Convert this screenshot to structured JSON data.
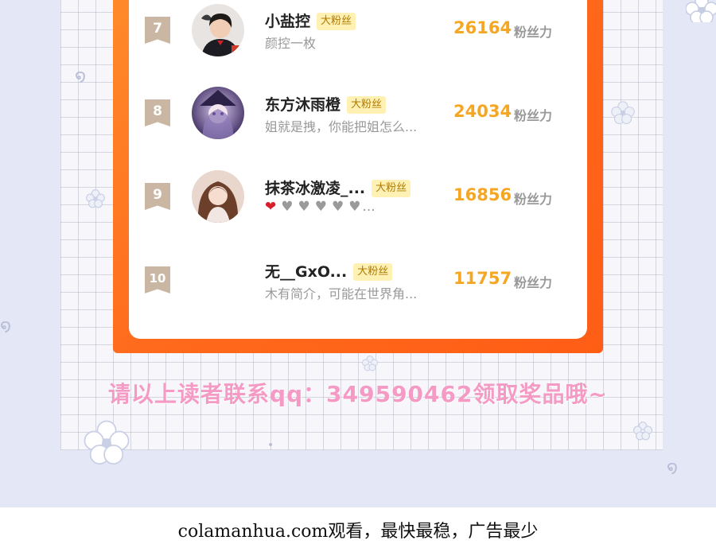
{
  "ranking": {
    "rows": [
      {
        "rank": "7",
        "name": "小盐控",
        "badge": "大粉丝",
        "subtitle": "颜控一枚",
        "score": "26164",
        "unit": "粉丝力"
      },
      {
        "rank": "8",
        "name": "东方沐雨橙",
        "badge": "大粉丝",
        "subtitle": "姐就是拽，你能把姐怎么...",
        "score": "24034",
        "unit": "粉丝力"
      },
      {
        "rank": "9",
        "name": "抹茶冰激凌_...",
        "badge": "大粉丝",
        "subtitle_hearts": {
          "red": "❤",
          "grey": "♥",
          "ellipsis": "..."
        },
        "score": "16856",
        "unit": "粉丝力"
      },
      {
        "rank": "10",
        "name": "无__GxO...",
        "badge": "大粉丝",
        "subtitle": "木有简介，可能在世界角...",
        "score": "11757",
        "unit": "粉丝力"
      }
    ]
  },
  "banner": "请以上读者联系qq：349590462领取奖品哦~",
  "footer": "colamanhua.com观看，最快最稳，广告最少",
  "colors": {
    "frame": "#ff6a1c",
    "score": "#f5a623",
    "badge_bg": "#fff0b3",
    "banner": "#f59ac4",
    "background": "#e4e8f6"
  }
}
